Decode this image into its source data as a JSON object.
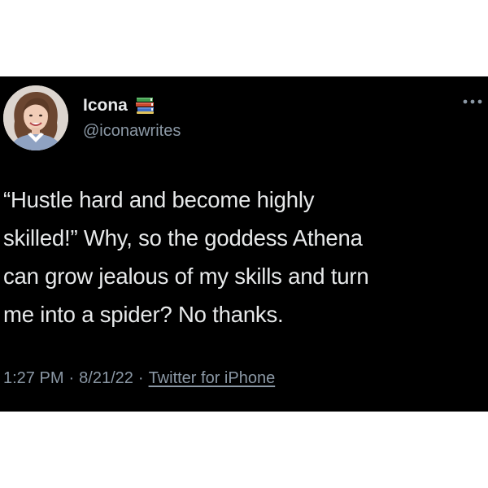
{
  "author": {
    "display_name": "Icona",
    "handle": "@iconawrites",
    "badge_icon": "books-icon",
    "avatar_icon": "profile-photo"
  },
  "menu": {
    "more_icon": "more-options-icon"
  },
  "tweet": {
    "text_lines": [
      "“Hustle hard and become highly",
      "skilled!” Why, so the goddess Athena",
      "can grow jealous of my skills and turn",
      "me into a spider? No thanks."
    ]
  },
  "meta": {
    "time": "1:27 PM",
    "separator": "·",
    "date": "8/21/22",
    "source": "Twitter for iPhone"
  },
  "colors": {
    "card_background": "#000000",
    "page_background": "#ffffff",
    "primary_text": "#e7e9ea",
    "secondary_text": "#8b98a5"
  }
}
